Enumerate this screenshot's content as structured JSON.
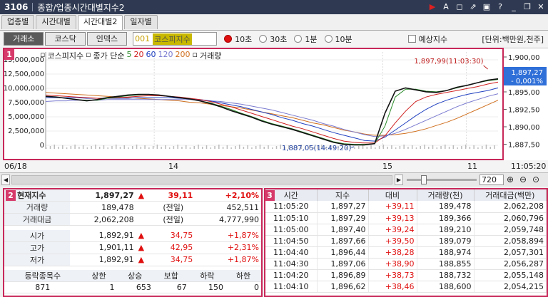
{
  "window": {
    "code": "3106",
    "title": "종합/업종시간대별지수2"
  },
  "titlebar_icons": [
    "play-icon",
    "font-icon",
    "window-icon",
    "link-icon",
    "maximize-icon",
    "help-icon",
    "minimize-icon",
    "restore-icon",
    "close-icon"
  ],
  "tabs": [
    "업종별",
    "시간대별",
    "시간대별2",
    "일자별"
  ],
  "active_tab": 2,
  "market_buttons": [
    "거래소",
    "코스닥",
    "인덱스"
  ],
  "active_market": 0,
  "index_code": "001",
  "index_name": "코스피지수",
  "intervals": [
    "10초",
    "30초",
    "1분",
    "10분"
  ],
  "selected_interval": 0,
  "estimate_label": "예상지수",
  "unit_label": "[단위:백만원,천주]",
  "chart": {
    "badge": "1",
    "legend": [
      {
        "label": "코스피지수",
        "color": "#222222"
      },
      {
        "label": "종가 단순",
        "color": "#222222"
      },
      {
        "label": "5",
        "color": "#2a8a2a"
      },
      {
        "label": "20",
        "color": "#d02020"
      },
      {
        "label": "60",
        "color": "#2040c0"
      },
      {
        "label": "120",
        "color": "#7a7ad0"
      },
      {
        "label": "200",
        "color": "#d07020"
      },
      {
        "label": "거래량",
        "color": "#222222"
      }
    ],
    "volume_ticks": [
      "15,000,000",
      "12,500,000",
      "10,000,000",
      "7,500,000",
      "5,000,000",
      "2,500,000",
      "0"
    ],
    "price_ticks": [
      "1,900,00",
      "1,897,50",
      "1,895,00",
      "1,892,50",
      "1,890,00",
      "1,887,50"
    ],
    "current_price": "1,897,27",
    "current_change": "- 0,001%",
    "high_annotation": "1,897,99(11:03:30)",
    "low_annotation": "1,887,05(14:49:20)",
    "date_labels": [
      "06/18",
      "14",
      "15",
      "11"
    ],
    "time_label": "11:05:20",
    "zoom_value": "720"
  },
  "chart_data": {
    "type": "line",
    "ylim": [
      1886.5,
      1901
    ],
    "y2lim": [
      0,
      15000000
    ],
    "series": [
      {
        "name": "코스피지수",
        "values": [
          1894.6,
          1894.5,
          1894.3,
          1894.1,
          1893.9,
          1894.1,
          1894.4,
          1894.6,
          1894.8,
          1894.9,
          1894.9,
          1894.8,
          1894.6,
          1894.4,
          1894.2,
          1893.9,
          1893.5,
          1893,
          1892.4,
          1891.9,
          1891.4,
          1890.8,
          1890.3,
          1889.9,
          1889.5,
          1889,
          1888.5,
          1888,
          1887.5,
          1887.2,
          1887.1,
          1887.1,
          1887.3,
          1892,
          1895.4,
          1895.9,
          1895.6,
          1895.3,
          1895.2,
          1895.5,
          1896,
          1896.3,
          1896.7,
          1897.1,
          1897.3
        ]
      },
      {
        "name": "5",
        "values": [
          1894.6,
          1894.5,
          1894.3,
          1894.1,
          1894,
          1894,
          1894.3,
          1894.5,
          1894.7,
          1894.8,
          1894.9,
          1894.8,
          1894.6,
          1894.4,
          1894.2,
          1893.9,
          1893.6,
          1893.1,
          1892.6,
          1892,
          1891.5,
          1890.9,
          1890.4,
          1890,
          1889.6,
          1889.1,
          1888.6,
          1888.1,
          1887.6,
          1887.3,
          1887.2,
          1887.2,
          1887.3,
          1890,
          1894.5,
          1895.7,
          1895.7,
          1895.4,
          1895.3,
          1895.5,
          1895.9,
          1896.3,
          1896.7,
          1897,
          1897.2
        ]
      },
      {
        "name": "20",
        "values": [
          1894.8,
          1894.7,
          1894.6,
          1894.5,
          1894.4,
          1894.3,
          1894.3,
          1894.4,
          1894.5,
          1894.6,
          1894.7,
          1894.7,
          1894.6,
          1894.5,
          1894.3,
          1894.1,
          1893.8,
          1893.4,
          1893,
          1892.5,
          1892,
          1891.5,
          1891,
          1890.5,
          1890,
          1889.6,
          1889.1,
          1888.6,
          1888.1,
          1887.7,
          1887.5,
          1887.4,
          1887.4,
          1888.5,
          1890.5,
          1892.3,
          1893.8,
          1894.5,
          1894.9,
          1895.2,
          1895.5,
          1895.8,
          1896.1,
          1896.5,
          1896.8
        ]
      },
      {
        "name": "60",
        "values": [
          1894.4,
          1894.4,
          1894.4,
          1894.4,
          1894.3,
          1894.3,
          1894.3,
          1894.3,
          1894.3,
          1894.4,
          1894.4,
          1894.4,
          1894.4,
          1894.3,
          1894.2,
          1894.1,
          1893.9,
          1893.6,
          1893.3,
          1893,
          1892.6,
          1892.2,
          1891.8,
          1891.3,
          1890.9,
          1890.4,
          1890,
          1889.5,
          1889,
          1888.6,
          1888.2,
          1887.8,
          1887.7,
          1888.3,
          1889.4,
          1890.5,
          1891.6,
          1892.6,
          1893.4,
          1894,
          1894.5,
          1894.9,
          1895.2,
          1895.5,
          1895.9
        ]
      },
      {
        "name": "120",
        "values": [
          1893.8,
          1893.9,
          1893.9,
          1894,
          1894,
          1894,
          1894.1,
          1894.1,
          1894.1,
          1894.1,
          1894.1,
          1894.1,
          1894.1,
          1894.1,
          1894.1,
          1894,
          1893.9,
          1893.8,
          1893.6,
          1893.4,
          1893.1,
          1892.8,
          1892.5,
          1892.1,
          1891.7,
          1891.3,
          1890.9,
          1890.4,
          1890,
          1889.5,
          1889.1,
          1888.7,
          1888.4,
          1888.5,
          1888.9,
          1889.5,
          1890.2,
          1890.9,
          1891.6,
          1892.3,
          1893,
          1893.6,
          1894.1,
          1894.6,
          1895
        ]
      },
      {
        "name": "200",
        "values": [
          1895.2,
          1895.1,
          1895,
          1894.9,
          1894.8,
          1894.7,
          1894.6,
          1894.5,
          1894.4,
          1894.3,
          1894.2,
          1894.1,
          1894,
          1893.9,
          1893.7,
          1893.6,
          1893.4,
          1893.2,
          1893,
          1892.8,
          1892.5,
          1892.2,
          1891.9,
          1891.6,
          1891.3,
          1890.9,
          1890.5,
          1890.2,
          1889.8,
          1889.4,
          1889.1,
          1888.8,
          1888.6,
          1888.6,
          1888.7,
          1888.9,
          1889.2,
          1889.6,
          1890.1,
          1890.6,
          1891.2,
          1891.9,
          1892.6,
          1893.3,
          1894
        ]
      }
    ]
  },
  "summary": {
    "badge": "2",
    "current": {
      "label": "현재지수",
      "value": "1,897,27",
      "change": "39,11",
      "pct": "+2,10%"
    },
    "rows": [
      {
        "label": "거래량",
        "value": "189,478",
        "sub": "(전일)",
        "prev": "452,511"
      },
      {
        "label": "거래대금",
        "value": "2,062,208",
        "sub": "(전일)",
        "prev": "4,777,990"
      }
    ],
    "ohl": [
      {
        "label": "시가",
        "value": "1,892,91",
        "change": "34,75",
        "pct": "+1,87%"
      },
      {
        "label": "고가",
        "value": "1,901,11",
        "change": "42,95",
        "pct": "+2,31%"
      },
      {
        "label": "저가",
        "value": "1,892,91",
        "change": "34,75",
        "pct": "+1,87%"
      }
    ],
    "breadth_headers": [
      "등락종목수",
      "상한",
      "상승",
      "보합",
      "하락",
      "하한"
    ],
    "breadth_values": [
      "871",
      "1",
      "653",
      "67",
      "150",
      "0"
    ]
  },
  "ticks": {
    "badge": "3",
    "headers": [
      "시간",
      "지수",
      "대비",
      "거래량(천)",
      "거래대금(백만)"
    ],
    "rows": [
      [
        "11:05:20",
        "1,897,27",
        "+39,11",
        "189,478",
        "2,062,208"
      ],
      [
        "11:05:10",
        "1,897,29",
        "+39,13",
        "189,366",
        "2,060,796"
      ],
      [
        "11:05:00",
        "1,897,40",
        "+39,24",
        "189,210",
        "2,059,748"
      ],
      [
        "11:04:50",
        "1,897,66",
        "+39,50",
        "189,079",
        "2,058,894"
      ],
      [
        "11:04:40",
        "1,896,44",
        "+38,28",
        "188,974",
        "2,057,301"
      ],
      [
        "11:04:30",
        "1,897,06",
        "+38,90",
        "188,855",
        "2,056,287"
      ],
      [
        "11:04:20",
        "1,896,89",
        "+38,73",
        "188,732",
        "2,055,148"
      ],
      [
        "11:04:10",
        "1,896,62",
        "+38,46",
        "188,600",
        "2,054,215"
      ]
    ]
  }
}
